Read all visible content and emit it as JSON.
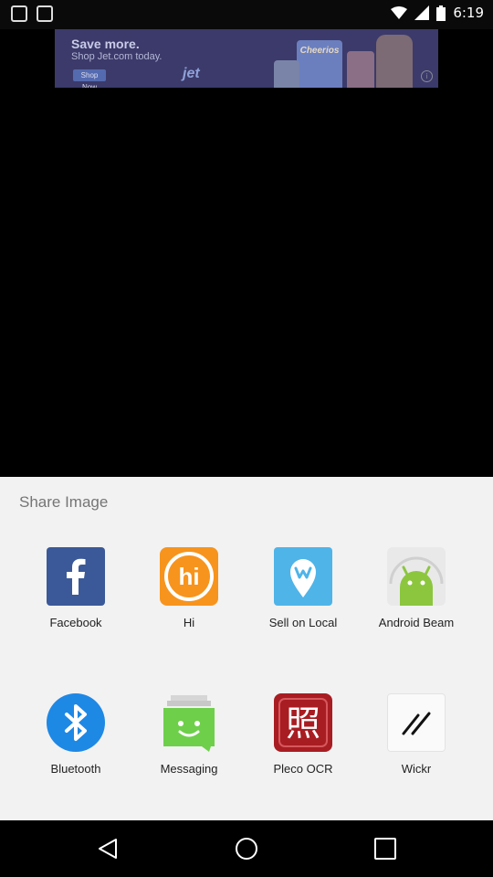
{
  "status_bar": {
    "time": "6:19"
  },
  "ad": {
    "headline": "Save more.",
    "subline": "Shop Jet.com today.",
    "button": "Shop Now",
    "brand": "jet",
    "product": "Cheerios"
  },
  "share_sheet": {
    "title": "Share Image",
    "apps": [
      {
        "label": "Facebook",
        "icon": "facebook-icon"
      },
      {
        "label": "Hi",
        "icon": "hi-icon"
      },
      {
        "label": "Sell on Local",
        "icon": "sell-on-local-icon"
      },
      {
        "label": "Android Beam",
        "icon": "android-beam-icon"
      },
      {
        "label": "Bluetooth",
        "icon": "bluetooth-icon"
      },
      {
        "label": "Messaging",
        "icon": "messaging-icon"
      },
      {
        "label": "Pleco OCR",
        "icon": "pleco-ocr-icon"
      },
      {
        "label": "Wickr",
        "icon": "wickr-icon"
      }
    ]
  },
  "colors": {
    "facebook": "#3b5998",
    "hi": "#f7941d",
    "sell_on_local": "#4fb4e8",
    "android": "#8cc63f",
    "bluetooth": "#1e88e5",
    "messaging": "#6ecf4b",
    "pleco": "#a81d22"
  }
}
